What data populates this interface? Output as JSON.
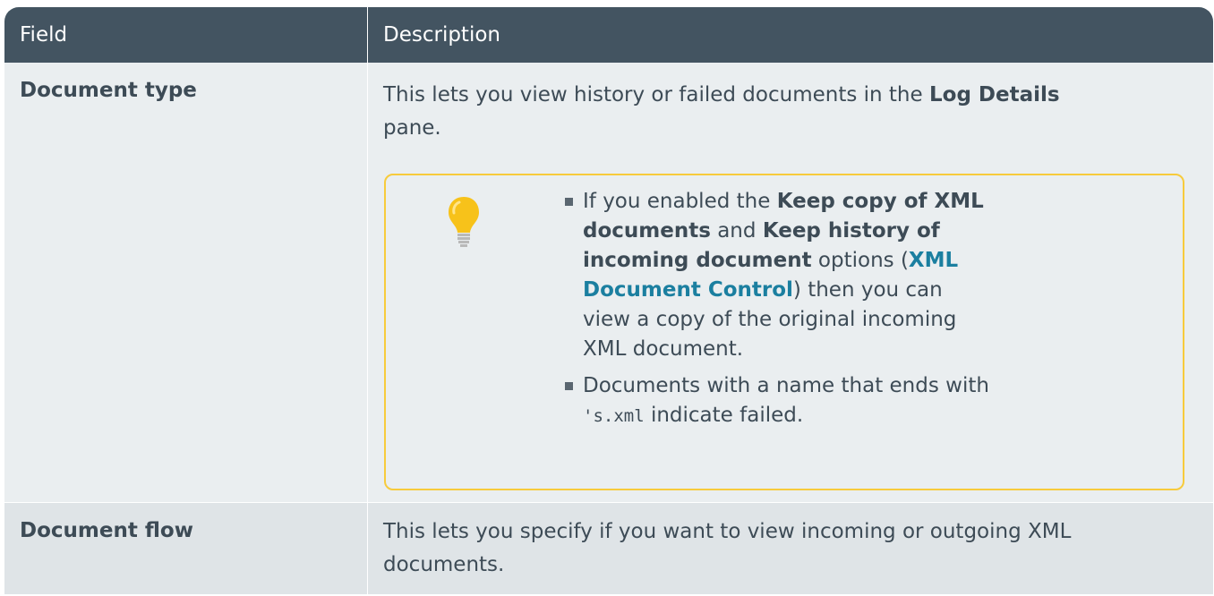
{
  "table": {
    "headers": {
      "field": "Field",
      "description": "Description"
    },
    "rows": [
      {
        "field": "Document type",
        "description_line1_pre": "This lets you view history or failed documents in the ",
        "description_line1_bold": "Log Details",
        "description_line2": "pane.",
        "tip": {
          "icon": "lightbulb-icon",
          "items": [
            {
              "t1": "If you enabled the ",
              "b1": "Keep copy of XML documents",
              "t2": " and ",
              "b2": "Keep history of incoming document",
              "t3": " options (",
              "link": "XML Document Control",
              "t4": ") then you can view a copy of the original incoming XML document."
            },
            {
              "t1": "Documents with a name that ends with ",
              "code": "'s.xml",
              "t2": " indicate failed."
            }
          ]
        }
      },
      {
        "field": "Document flow",
        "description": "This lets you specify if you want to view incoming or outgoing XML documents."
      }
    ]
  },
  "colors": {
    "header_bg": "#435461",
    "row_bg": "#eaeef0",
    "row_alt_bg": "#dfe4e7",
    "tip_border": "#f7cb3c",
    "link": "#1b7fa0"
  }
}
